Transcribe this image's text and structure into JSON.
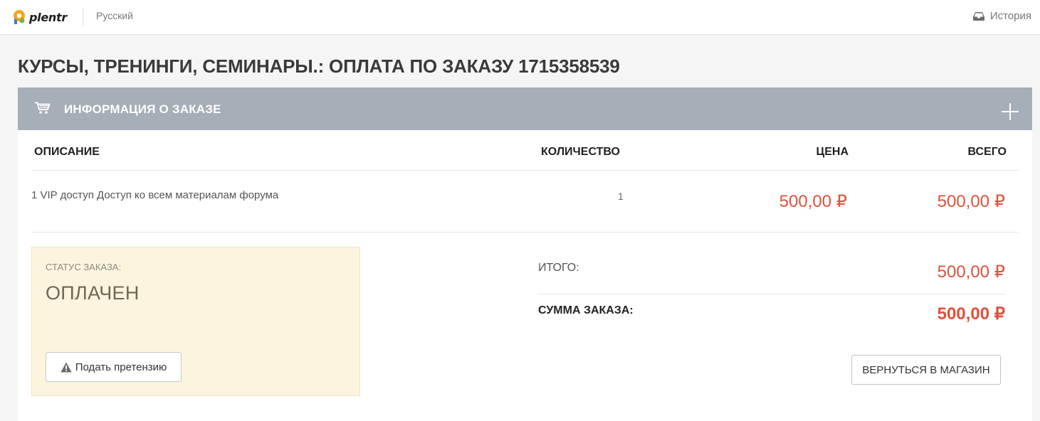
{
  "topbar": {
    "logo_text": "plentr",
    "language": "Русский",
    "history_label": "История"
  },
  "page": {
    "title": "Курсы, тренинги, семинары.: Оплата по заказу 1715358539"
  },
  "panel": {
    "header_title": "Информация о заказе",
    "icons": {
      "cart": "cart-icon",
      "expand": "plus-icon"
    }
  },
  "table": {
    "columns": [
      "Описание",
      "Количество",
      "Цена",
      "Всего"
    ],
    "rows": [
      {
        "description": "1 VIP доступ Доступ ко всем материалам форума",
        "quantity": "1",
        "price": "500,00 ₽",
        "total": "500,00 ₽"
      }
    ]
  },
  "status": {
    "label": "Статус заказа:",
    "value": "Оплачен",
    "claim_button": "Подать претензию"
  },
  "summary": {
    "subtotal_label": "Итого:",
    "subtotal_value": "500,00 ₽",
    "total_label": "Сумма заказа:",
    "total_value": "500,00 ₽",
    "back_button": "Вернуться в магазин"
  },
  "colors": {
    "accent_price": "#e1503b",
    "header_bg": "#a6aeb8",
    "status_bg": "#fdf4de"
  }
}
